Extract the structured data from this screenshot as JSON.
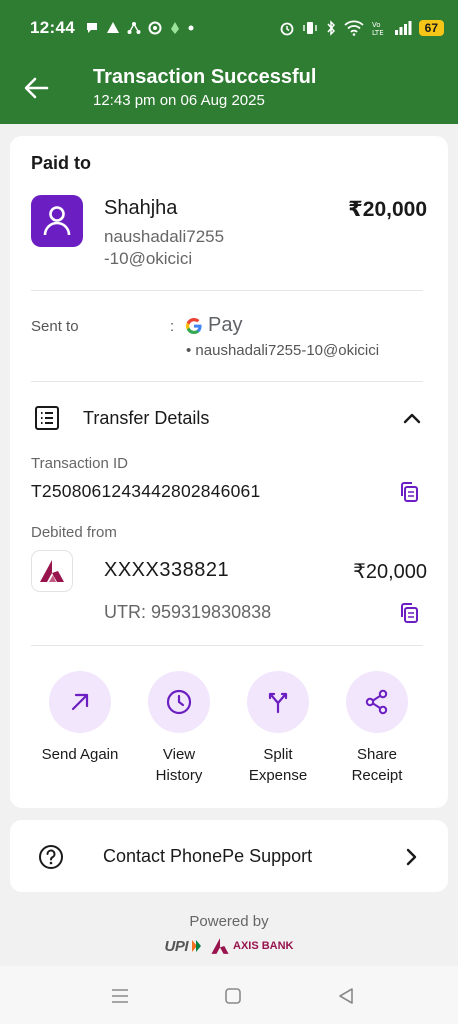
{
  "status_bar": {
    "time": "12:44",
    "battery": "67",
    "notification_icons": [
      "chat-icon",
      "signal-app-icon",
      "network-app-icon",
      "sync-icon",
      "vpn-icon",
      "dot-icon"
    ],
    "system_icons": [
      "alarm-icon",
      "vibrate-icon",
      "bluetooth-icon",
      "wifi-icon",
      "volte-icon",
      "signal-icon",
      "battery-icon"
    ]
  },
  "header": {
    "title": "Transaction Successful",
    "subtitle": "12:43 pm on 06 Aug 2025",
    "background_color": "#2f7d32"
  },
  "paid_to": {
    "label": "Paid to",
    "name": "Shahjha",
    "vpa": "naushadali7255 -10@okicici",
    "amount": "₹20,000",
    "avatar_color": "#6b1fc2"
  },
  "sent_to": {
    "label": "Sent to",
    "colon": ":",
    "app": "Pay",
    "vpa": "• naushadali7255-10@okicici"
  },
  "transfer_details": {
    "title": "Transfer Details",
    "transaction_id_label": "Transaction ID",
    "transaction_id": "T2508061243442802846061",
    "debited_from_label": "Debited from",
    "account": "XXXX338821",
    "account_amount": "₹20,000",
    "utr": "UTR: 959319830838"
  },
  "actions": [
    {
      "label": "Send Again",
      "icon": "arrow-up-right-icon"
    },
    {
      "label": "View History",
      "icon": "clock-icon"
    },
    {
      "label": "Split Expense",
      "icon": "split-icon"
    },
    {
      "label": "Share Receipt",
      "icon": "share-icon"
    }
  ],
  "support": {
    "label": "Contact PhonePe Support"
  },
  "footer": {
    "powered_by": "Powered by",
    "upi_logo_text": "UPI",
    "bank_logo_text": "AXIS BANK"
  },
  "accent_color": "#6b1fc2"
}
